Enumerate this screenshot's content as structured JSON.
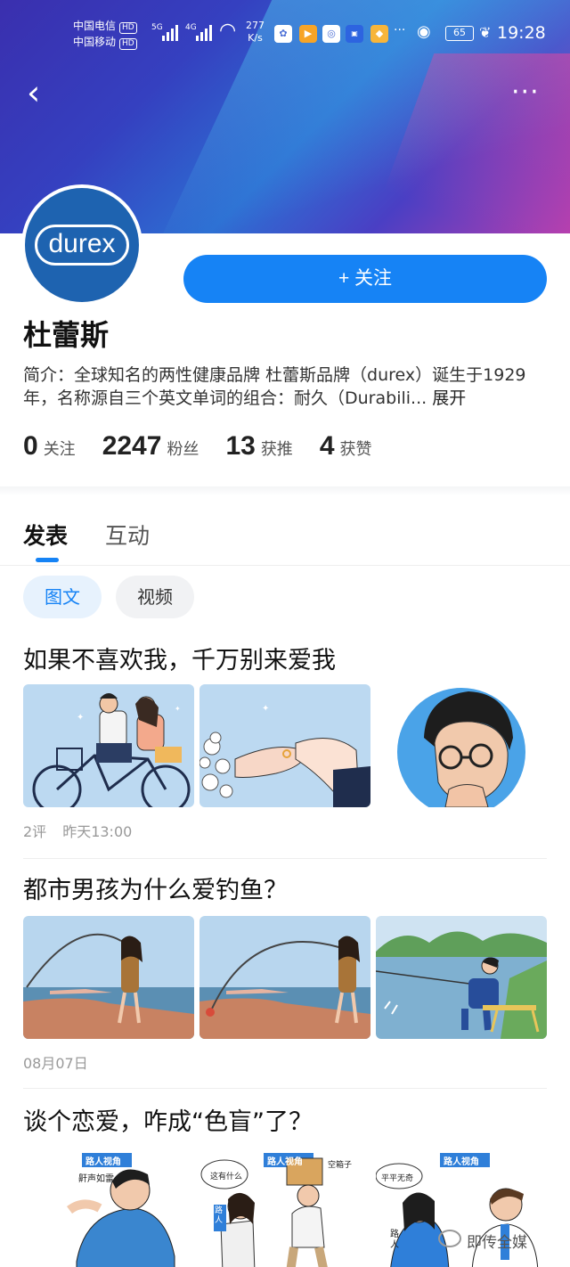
{
  "status_bar": {
    "carrier1": "中国电信",
    "carrier2": "中国移动",
    "hd": "HD",
    "net1": "5G",
    "net2": "4G",
    "speed_value": "277",
    "speed_unit": "K/s",
    "battery": "65",
    "time": "19:28"
  },
  "nav": {
    "back_glyph": "‹",
    "more_glyph": "···"
  },
  "profile": {
    "logo_text": "durex",
    "follow_label": "+ 关注",
    "name": "杜蕾斯",
    "bio": "简介：全球知名的两性健康品牌 杜蕾斯品牌（durex）诞生于1929年，名称源自三个英文单词的组合：耐久（Durabili...",
    "bio_expand": "展开"
  },
  "stats": [
    {
      "value": "0",
      "label": "关注"
    },
    {
      "value": "2247",
      "label": "粉丝"
    },
    {
      "value": "13",
      "label": "获推"
    },
    {
      "value": "4",
      "label": "获赞"
    }
  ],
  "tabs": [
    "发表",
    "互动"
  ],
  "chips": [
    "图文",
    "视频"
  ],
  "posts": [
    {
      "title": "如果不喜欢我，千万别来爱我",
      "comments": "2评",
      "time": "昨天13:00"
    },
    {
      "title": "都市男孩为什么爱钓鱼？",
      "comments": "",
      "time": "08月07日"
    },
    {
      "title": "谈个恋爱，咋成“色盲”了？",
      "comments": "",
      "time": ""
    }
  ],
  "comic_labels": {
    "tag": "路人视角",
    "b1": "鼾声如雷",
    "b2": "这有什么",
    "b3": "空箱子",
    "b4": "平平无奇",
    "p1": "路人",
    "p2": "路人"
  },
  "watermark": "即传全媒",
  "colors": {
    "accent": "#1683f5",
    "logo_bg": "#1e63b0"
  }
}
